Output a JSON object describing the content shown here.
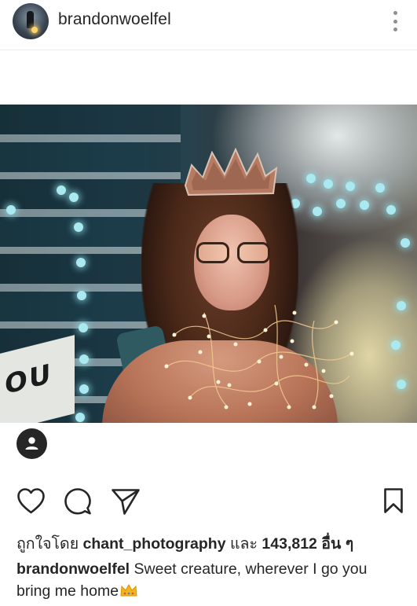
{
  "post": {
    "username": "brandonwoelfel",
    "icons": {
      "avatar": "profile-photo-avatar",
      "more": "more-options-icon",
      "tagged_user": "user-profile-icon"
    }
  },
  "actions": {
    "like_icon": "heart-icon",
    "comment_icon": "comment-icon",
    "share_icon": "send-icon",
    "save_icon": "bookmark-icon"
  },
  "likes": {
    "prefix": "ถูกใจโดย",
    "user": "chant_photography",
    "joiner": "และ",
    "count": "143,812 อื่น ๆ"
  },
  "caption": {
    "username": "brandonwoelfel",
    "text": "Sweet creature, wherever I go you bring me home",
    "emoji": "crown-emoji"
  },
  "photo": {
    "sign_text": "OU"
  },
  "colors": {
    "text": "#262626",
    "divider": "#ececec",
    "muted": "#8e8e8e"
  }
}
